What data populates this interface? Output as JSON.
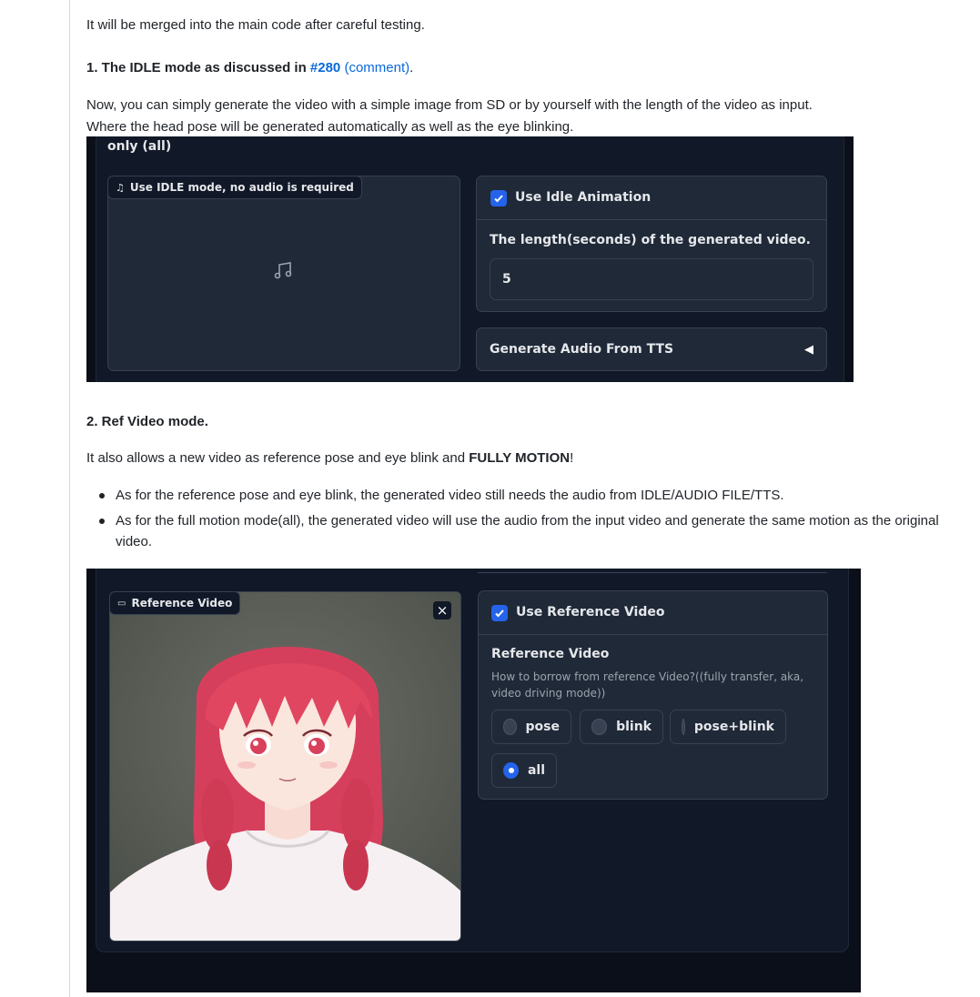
{
  "intro": "It will be merged into the main code after careful testing.",
  "section1": {
    "heading_prefix": "1. The IDLE mode as discussed in ",
    "link_issue": "#280",
    "link_comment": "(comment)",
    "heading_suffix": ".",
    "desc_line1": "Now, you can simply generate the video with a simple image from SD or by yourself with the length of the video as input.",
    "desc_line2": "Where the head pose will be generated automatically as well as the eye blinking."
  },
  "shot1": {
    "header_text": "only (all)",
    "audio_tag": "Use IDLE mode, no audio is required",
    "checkbox_label": "Use Idle Animation",
    "length_label": "The length(seconds) of the generated video.",
    "length_value": "5",
    "tts_label": "Generate Audio From TTS",
    "tts_arrow": "◀"
  },
  "section2": {
    "heading": "2. Ref Video mode.",
    "desc_prefix": "It also allows a new video as reference pose and eye blink and ",
    "desc_bold": "FULLY MOTION",
    "desc_suffix": "!",
    "bullets": [
      "As for the reference pose and eye blink, the generated video still needs the audio from IDLE/AUDIO FILE/TTS.",
      "As for the full motion mode(all), the generated video will use the audio from the input video and generate the same motion as the original video."
    ]
  },
  "shot2": {
    "video_tag": "Reference Video",
    "close": "×",
    "checkbox_label": "Use Reference Video",
    "ref_title": "Reference Video",
    "ref_desc": "How to borrow from reference Video?((fully transfer, aka, video driving mode))",
    "options": [
      "pose",
      "blink",
      "pose+blink",
      "all"
    ],
    "selected": "all"
  },
  "colors": {
    "link": "#0969da",
    "accent": "#2563eb",
    "panel_bg": "#0b0f19"
  }
}
